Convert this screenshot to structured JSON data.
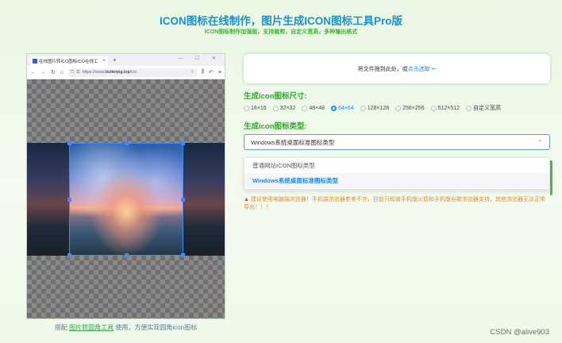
{
  "header": {
    "title": "ICON图标在线制作，图片生成ICON图标工具Pro版",
    "subtitle": "ICON图标制作加强版，支持裁剪，自定义宽高，多种输出格式"
  },
  "browser": {
    "tab_title": "在线图片转ICO图标ICO在线工",
    "tab_close": "×",
    "new_tab": "+",
    "window_controls": "— ☐ ✕",
    "url_prefix": "https://www.",
    "url_domain": "butterpig.top",
    "url_suffix": "/ico"
  },
  "left_caption": {
    "prefix": "搭配",
    "link": "图片转圆角工具",
    "suffix": "使用，方便实现圆角icon图标"
  },
  "dropzone": {
    "text": "将文件拖到此处，或",
    "link": "点击选取",
    "icon": "↩"
  },
  "size_section": {
    "title": "生成icon图标尺寸:",
    "options": [
      "16×16",
      "32×32",
      "48×48",
      "64×64",
      "128×128",
      "256×256",
      "512×512",
      "自定义宽高"
    ],
    "selected": "64×64"
  },
  "type_section": {
    "title": "生成icon图标类型:",
    "selected": "Windows系统桌面标准图标类型",
    "chevron": "⌃",
    "options": [
      "普通网站ICON图标类型",
      "Windows系统桌面标准图标类型"
    ]
  },
  "warning": {
    "icon": "▲",
    "text": "建议使用电脑端浏览器！手机端浏览器参差不齐，目前只知道手机版火狐和手机版谷歌浏览器支持，其他浏览器无法正常导出！！！"
  },
  "watermark": "CSDN @alive903",
  "colors": {
    "title": "#1f8fc4",
    "accent_green": "#35a52f",
    "link_blue": "#1e88e5",
    "warning": "#e58a2e"
  }
}
